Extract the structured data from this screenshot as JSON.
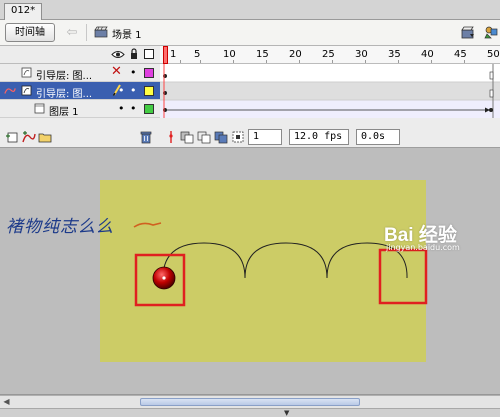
{
  "document": {
    "tab_label": "012*"
  },
  "toolbar": {
    "timeline_button": "时间轴",
    "back_icon": "left-arrow-icon",
    "scene_icon": "clapperboard-icon",
    "scene_label": "场景 1",
    "edit_scene_icon": "edit-scene-icon",
    "edit_symbol_icon": "edit-symbol-icon"
  },
  "timeline": {
    "header_icons": [
      "eye-icon",
      "lock-icon",
      "outline-icon"
    ],
    "ruler": [
      "1",
      "5",
      "10",
      "15",
      "20",
      "25",
      "30",
      "35",
      "40",
      "45",
      "50"
    ],
    "layers": [
      {
        "name": "引导层: 图...",
        "icon": "guide-layer-icon",
        "visible": "x",
        "color": "#e040e0",
        "selected": false
      },
      {
        "name": "引导层: 图...",
        "icon": "motion-guide-icon",
        "visible": "pencil",
        "color": "#ffff44",
        "selected": true
      },
      {
        "name": "图层 1",
        "icon": "layer-icon",
        "visible": "dot",
        "color": "#44cc44",
        "selected": false
      }
    ],
    "bottom": {
      "current_frame": "1",
      "frame_rate": "12.0 fps",
      "elapsed_time": "0.0s",
      "icons": [
        "insert-layer-icon",
        "add-guide-icon",
        "insert-folder-icon",
        "delete-layer-icon",
        "center-frame-icon",
        "onion-skin-icon",
        "onion-outline-icon",
        "edit-multiple-frames-icon",
        "onion-markers-icon"
      ]
    }
  },
  "stage": {
    "background": "#cccc66",
    "ball_color": "#c00000",
    "highlight_color": "#e02020"
  },
  "watermark": {
    "left_text": "褚物纯志么么",
    "right_logo": "Bai 经验",
    "right_sub": "jingyan.baidu.com"
  },
  "colors": {
    "selection": "#3a5fb0",
    "playhead": "#ff4444"
  }
}
